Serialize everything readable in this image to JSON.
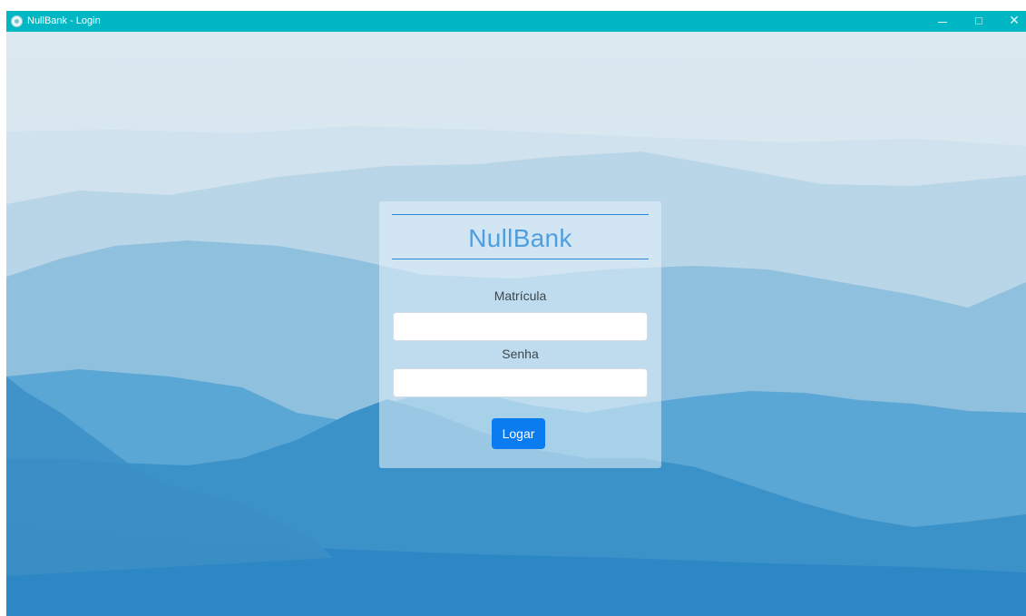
{
  "window": {
    "title": "NullBank - Login",
    "titlebar_color": "#00b7c3",
    "controls": {
      "minimize_icon": "minimize-icon",
      "maximize_icon": "maximize-icon",
      "close_icon": "close-icon",
      "close_glyph": "✕"
    }
  },
  "background": {
    "description_icon": "mountain-landscape-image",
    "colors": [
      "#dce9f1",
      "#b5d4e6",
      "#7fb5d8",
      "#3f93c9",
      "#2e86c3"
    ]
  },
  "login": {
    "brand": "NullBank",
    "matricula_label": "Matrícula",
    "matricula_value": "",
    "senha_label": "Senha",
    "senha_value": "",
    "submit_label": "Logar",
    "accent_color": "#0b7cf0"
  }
}
